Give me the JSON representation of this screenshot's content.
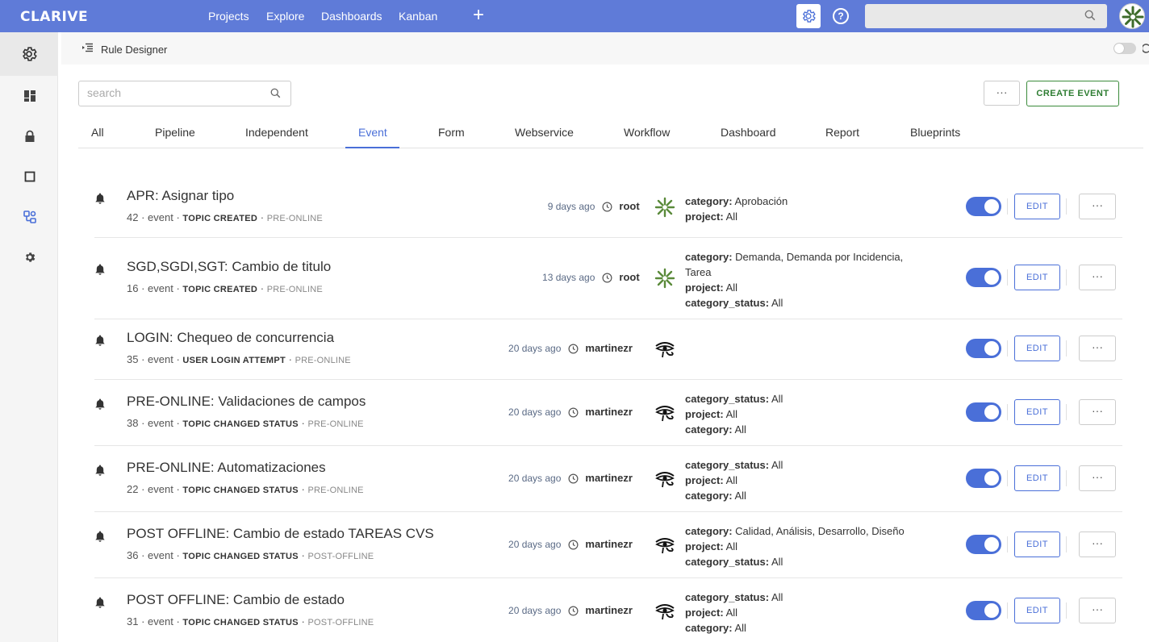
{
  "app": {
    "logo": "CLARIVE"
  },
  "topnav": {
    "items": [
      "Projects",
      "Explore",
      "Dashboards",
      "Kanban"
    ],
    "plus": "+",
    "help": "?",
    "accent_color": "#5f7bd8"
  },
  "breadcrumb": {
    "title": "Rule Designer"
  },
  "toolbar": {
    "search_placeholder": "search",
    "more": "···",
    "create_label": "CREATE EVENT"
  },
  "tabs": [
    "All",
    "Pipeline",
    "Independent",
    "Event",
    "Form",
    "Webservice",
    "Workflow",
    "Dashboard",
    "Report",
    "Blueprints"
  ],
  "active_tab": "Event",
  "rules": [
    {
      "title": "APR: Asignar tipo",
      "id": "42",
      "type": "event",
      "kind": "TOPIC CREATED",
      "state": "PRE-ONLINE",
      "when": "9 days ago",
      "user": "root",
      "user_icon": "snowflake-avatar",
      "props": [
        {
          "k": "category:",
          "v": "Aprobación"
        },
        {
          "k": "project:",
          "v": "All"
        }
      ],
      "enabled": true,
      "edit": "EDIT",
      "more": "···"
    },
    {
      "title": "SGD,SGDI,SGT: Cambio de titulo",
      "id": "16",
      "type": "event",
      "kind": "TOPIC CREATED",
      "state": "PRE-ONLINE",
      "when": "13 days ago",
      "user": "root",
      "user_icon": "snowflake-avatar",
      "props": [
        {
          "k": "category:",
          "v": "Demanda, Demanda por Incidencia,"
        },
        {
          "k": "",
          "v": "Tarea"
        },
        {
          "k": "project:",
          "v": "All"
        },
        {
          "k": "category_status:",
          "v": "All"
        }
      ],
      "enabled": true,
      "edit": "EDIT",
      "more": "···"
    },
    {
      "title": "LOGIN: Chequeo de concurrencia",
      "id": "35",
      "type": "event",
      "kind": "USER LOGIN ATTEMPT",
      "state": "PRE-ONLINE",
      "when": "20 days ago",
      "user": "martinezr",
      "user_icon": "eye-of-horus-avatar",
      "props": [],
      "enabled": true,
      "edit": "EDIT",
      "more": "···"
    },
    {
      "title": "PRE-ONLINE: Validaciones de campos",
      "id": "38",
      "type": "event",
      "kind": "TOPIC CHANGED STATUS",
      "state": "PRE-ONLINE",
      "when": "20 days ago",
      "user": "martinezr",
      "user_icon": "eye-of-horus-avatar",
      "props": [
        {
          "k": "category_status:",
          "v": "All"
        },
        {
          "k": "project:",
          "v": "All"
        },
        {
          "k": "category:",
          "v": "All"
        }
      ],
      "enabled": true,
      "edit": "EDIT",
      "more": "···"
    },
    {
      "title": "PRE-ONLINE: Automatizaciones",
      "id": "22",
      "type": "event",
      "kind": "TOPIC CHANGED STATUS",
      "state": "PRE-ONLINE",
      "when": "20 days ago",
      "user": "martinezr",
      "user_icon": "eye-of-horus-avatar",
      "props": [
        {
          "k": "category_status:",
          "v": "All"
        },
        {
          "k": "project:",
          "v": "All"
        },
        {
          "k": "category:",
          "v": "All"
        }
      ],
      "enabled": true,
      "edit": "EDIT",
      "more": "···"
    },
    {
      "title": "POST OFFLINE: Cambio de estado TAREAS CVS",
      "id": "36",
      "type": "event",
      "kind": "TOPIC CHANGED STATUS",
      "state": "POST-OFFLINE",
      "when": "20 days ago",
      "user": "martinezr",
      "user_icon": "eye-of-horus-avatar",
      "props": [
        {
          "k": "category:",
          "v": "Calidad, Análisis, Desarrollo, Diseño"
        },
        {
          "k": "project:",
          "v": "All"
        },
        {
          "k": "category_status:",
          "v": "All"
        }
      ],
      "enabled": true,
      "edit": "EDIT",
      "more": "···"
    },
    {
      "title": "POST OFFLINE: Cambio de estado",
      "id": "31",
      "type": "event",
      "kind": "TOPIC CHANGED STATUS",
      "state": "POST-OFFLINE",
      "when": "20 days ago",
      "user": "martinezr",
      "user_icon": "eye-of-horus-avatar",
      "props": [
        {
          "k": "category_status:",
          "v": "All"
        },
        {
          "k": "project:",
          "v": "All"
        },
        {
          "k": "category:",
          "v": "All"
        }
      ],
      "enabled": true,
      "edit": "EDIT",
      "more": "···"
    }
  ]
}
